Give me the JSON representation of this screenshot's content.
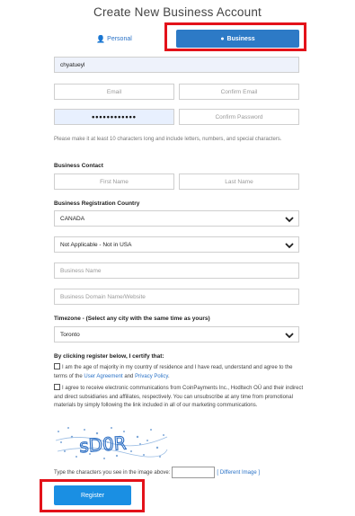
{
  "page": {
    "title": "Create New Business Account"
  },
  "tabs": {
    "personal_label": "Personal",
    "business_label": "Business"
  },
  "form": {
    "username_value": "chyatueyl",
    "email_placeholder": "Email",
    "confirm_email_placeholder": "Confirm Email",
    "password_value": "••••••••••••",
    "confirm_password_placeholder": "Confirm Password",
    "password_help": "Please make it at least 10 characters long and include letters, numbers, and special characters.",
    "business_contact_label": "Business Contact",
    "first_name_placeholder": "First Name",
    "last_name_placeholder": "Last Name",
    "registration_country_label": "Business Registration Country",
    "country_value": "CANADA",
    "state_value": "Not Applicable - Not in USA",
    "business_name_placeholder": "Business Name",
    "business_domain_placeholder": "Business Domain Name/Website",
    "timezone_label": "Timezone - (Select any city with the same time as yours)",
    "timezone_value": "Toronto"
  },
  "terms": {
    "certify_label": "By clicking register below, I certify that:",
    "age_text_1": "I am the age of majority in my country of residence and I have read, understand and agree to the terms of the ",
    "user_agreement_link": "User Agreement",
    "and_text": " and ",
    "privacy_policy_link": "Privacy Policy",
    "period": ".",
    "comms_text": "I agree to receive electronic communications from CoinPayments Inc., Hodltech OÜ and their indirect and direct subsidiaries and affiliates, respectively. You can unsubscribe at any time from promotional materials by simply following the link included in all of our marketing communications."
  },
  "captcha": {
    "image_text": "sD0R",
    "prompt": "Type the characters you see in the image above:",
    "different_image_link": "[ Different Image ]"
  },
  "actions": {
    "register_label": "Register"
  },
  "colors": {
    "accent": "#2d7ac6",
    "register": "#1a8fe3",
    "highlight": "#e3121a"
  }
}
